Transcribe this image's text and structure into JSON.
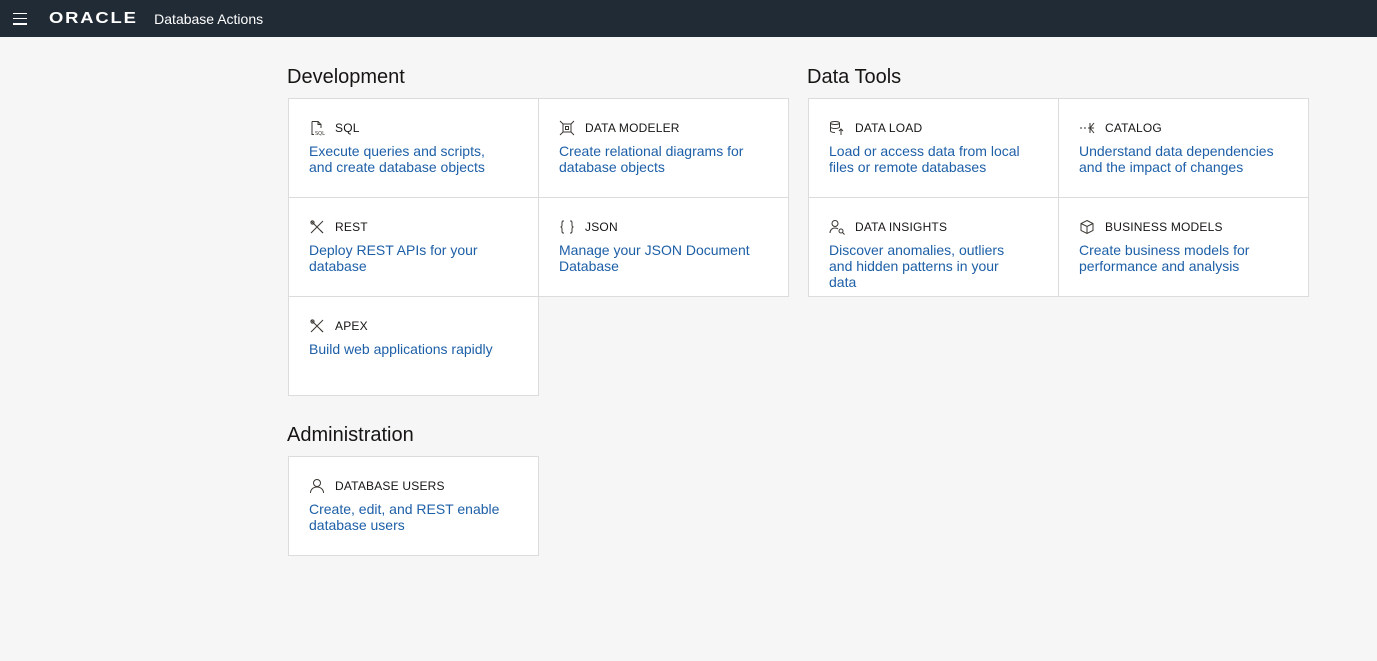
{
  "header": {
    "logo": "ORACLE",
    "title": "Database Actions"
  },
  "development": {
    "title": "Development",
    "cards": [
      {
        "name": "SQL",
        "desc": "Execute queries and scripts, and create database objects"
      },
      {
        "name": "DATA MODELER",
        "desc": "Create relational diagrams for database objects"
      },
      {
        "name": "REST",
        "desc": "Deploy REST APIs for your database"
      },
      {
        "name": "JSON",
        "desc": "Manage your JSON Document Database"
      },
      {
        "name": "APEX",
        "desc": "Build web applications rapidly"
      }
    ]
  },
  "data_tools": {
    "title": "Data Tools",
    "cards": [
      {
        "name": "DATA LOAD",
        "desc": "Load or access data from local files or remote databases"
      },
      {
        "name": "CATALOG",
        "desc": "Understand data dependencies and the impact of changes"
      },
      {
        "name": "DATA INSIGHTS",
        "desc": "Discover anomalies, outliers and hidden patterns in your data"
      },
      {
        "name": "BUSINESS MODELS",
        "desc": "Create business models for performance and analysis"
      }
    ]
  },
  "administration": {
    "title": "Administration",
    "cards": [
      {
        "name": "DATABASE USERS",
        "desc": "Create, edit, and REST enable database users"
      }
    ]
  },
  "colors": {
    "header_bg": "#212b36",
    "link": "#1d5fa7",
    "page_bg": "#f6f6f6"
  }
}
